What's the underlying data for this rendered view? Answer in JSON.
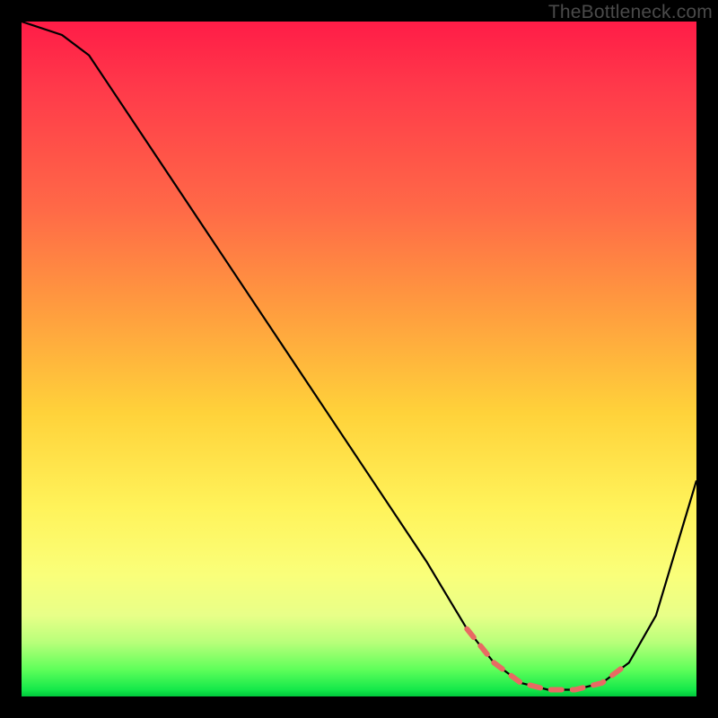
{
  "watermark": "TheBottleneck.com",
  "chart_data": {
    "type": "line",
    "title": "",
    "xlabel": "",
    "ylabel": "",
    "xlim": [
      0,
      100
    ],
    "ylim": [
      0,
      100
    ],
    "series": [
      {
        "name": "bottleneck-curve",
        "x": [
          0,
          6,
          10,
          20,
          30,
          40,
          50,
          60,
          66,
          70,
          74,
          78,
          82,
          86,
          90,
          94,
          100
        ],
        "values": [
          100,
          98,
          95,
          80,
          65,
          50,
          35,
          20,
          10,
          5,
          2,
          1,
          1,
          2,
          5,
          12,
          32
        ]
      }
    ],
    "dashed_region": {
      "name": "optimal-range",
      "x": [
        66,
        70,
        74,
        78,
        82,
        86,
        90
      ],
      "values": [
        10,
        5,
        2,
        1,
        1,
        2,
        5
      ]
    },
    "colors": {
      "curve_stroke": "#000000",
      "dash_stroke": "#e86a63",
      "gradient_top": "#ff1c47",
      "gradient_bottom": "#00c83c"
    }
  }
}
